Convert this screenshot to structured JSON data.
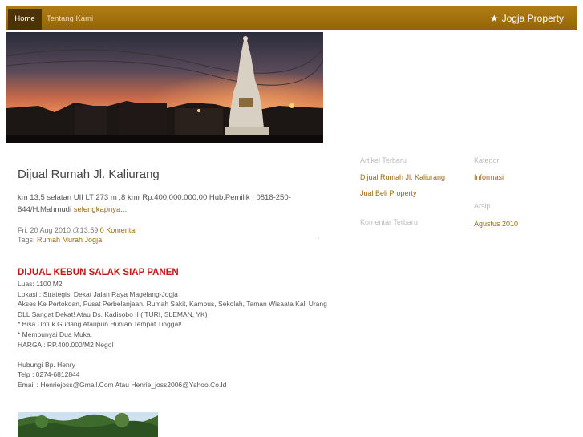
{
  "nav": {
    "home": "Home",
    "about": "Tentang Kami",
    "brand": "Jogja Property",
    "brand_icon": "star-icon"
  },
  "post": {
    "title": "Dijual Rumah Jl. Kaliurang",
    "excerpt": "km 13,5 selatan UII LT 273 m ,8 kmr Rp.400.000.000,00 Hub.Pemilik : 0818-250-844/H.Mahmudi",
    "more": "selengkapnya...",
    "date": "Fri, 20 Aug 2010 @13:59",
    "comments": "0 Komentar",
    "tags_label": "Tags:",
    "tag": "Rumah Murah Jogja"
  },
  "ad": {
    "title": "DIJUAL KEBUN SALAK SIAP PANEN",
    "lines": [
      "Luas: 1100 M2",
      "Lokasi : Strategis, Dekat Jalan Raya Magelang-Jogja",
      "Akses Ke Pertokoan, Pusat Perbelanjaan, Rumah Sakit, Kampus, Sekolah, Taman Wisaata Kali Urang",
      "DLL Sangat Dekat! Atau Ds. Kadisobo II ( TURI, SLEMAN, YK)",
      "* Bisa Untuk Gudang Ataupun Hunian Tempat Tinggal!",
      "* Mempunyai Dua Muka.",
      "HARGA : RP.400.000/M2 Nego!",
      "",
      "Hubungi Bp. Henry",
      "Telp : 0274-6812844",
      "Email : Henriejoss@Gmail.Com Atau Henrie_joss2006@Yahoo.Co.Id"
    ]
  },
  "sidebar": {
    "artikel_heading": "Artikel Terbaru",
    "artikel": [
      "Dijual Rumah Jl. Kaliurang",
      "Jual Beli Property"
    ],
    "komentar_heading": "Komentar Terbaru",
    "kategori_heading": "Kategori",
    "kategori": [
      "Informasi"
    ],
    "arsip_heading": "Arsip",
    "arsip": [
      "Agustus 2010"
    ]
  },
  "colors": {
    "accent": "#9a6b0e",
    "nav_bg": "#a47210",
    "ad_title": "#c01818"
  }
}
